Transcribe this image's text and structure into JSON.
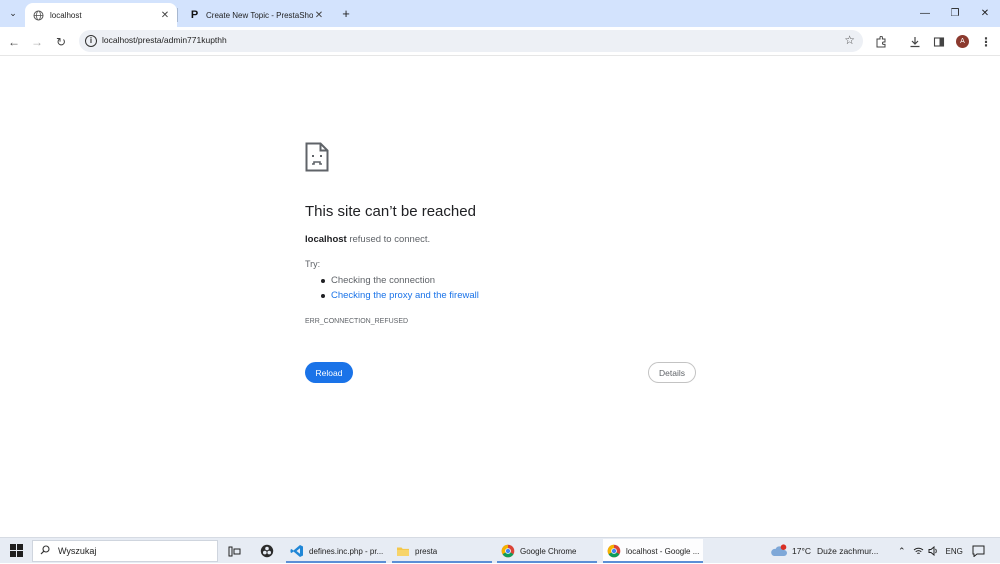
{
  "browser": {
    "tabs": [
      {
        "title": "localhost",
        "favicon": "globe-icon",
        "active": true
      },
      {
        "title": "Create New Topic - PrestaShop",
        "favicon": "prestashop-icon",
        "active": false
      }
    ],
    "address": "localhost/presta/admin771kupthh",
    "profile_initial": "A"
  },
  "error_page": {
    "title": "This site can’t be reached",
    "host": "localhost",
    "description_rest": " refused to connect.",
    "try_label": "Try:",
    "suggestions": [
      "Checking the connection",
      "Checking the proxy and the firewall"
    ],
    "error_code": "ERR_CONNECTION_REFUSED",
    "reload_label": "Reload",
    "details_label": "Details"
  },
  "taskbar": {
    "search_placeholder": "Wyszukaj",
    "apps": [
      {
        "label": "defines.inc.php - pr...",
        "icon": "vscode-icon",
        "active": false
      },
      {
        "label": "presta",
        "icon": "folder-icon",
        "active": false
      },
      {
        "label": "Google Chrome",
        "icon": "chrome-icon",
        "active": false
      },
      {
        "label": "localhost - Google ...",
        "icon": "chrome-icon",
        "active": true
      }
    ],
    "weather": {
      "temp": "17°C",
      "text": "Duże zachmur..."
    },
    "language": "ENG"
  },
  "colors": {
    "accent": "#1a73e8",
    "tabstrip": "#d3e3fd",
    "taskbar": "#e7ecf4"
  }
}
